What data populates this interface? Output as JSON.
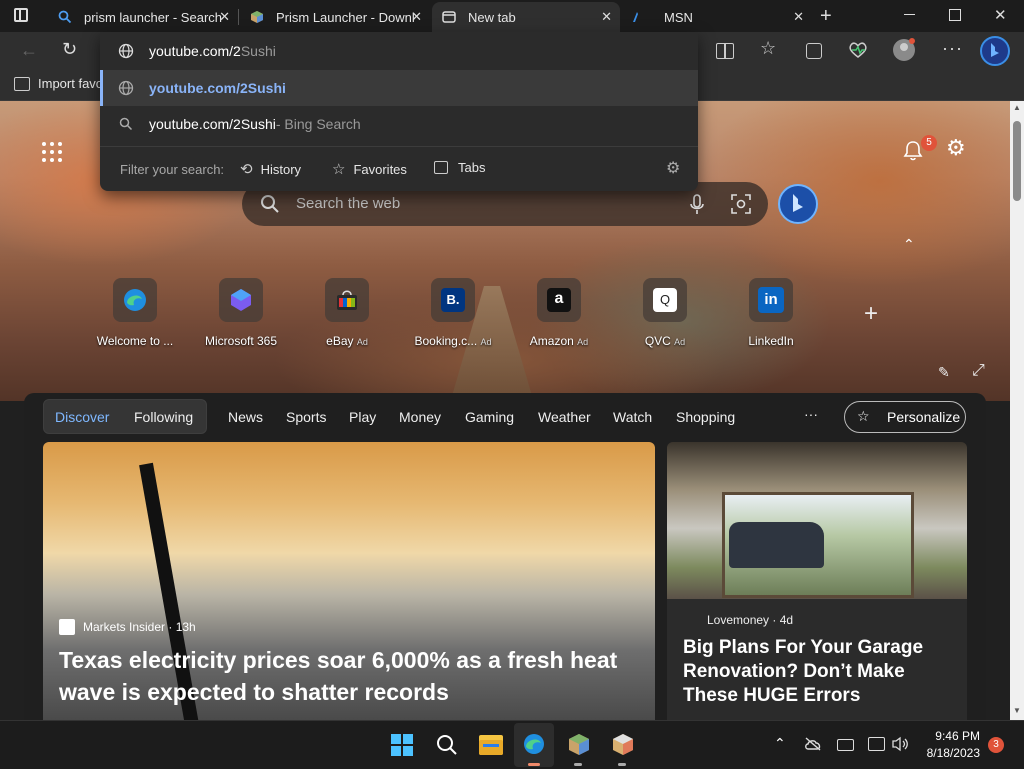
{
  "tabs": [
    {
      "label": "prism launcher - Search",
      "icon": "search-favicon"
    },
    {
      "label": "Prism Launcher - Downl",
      "icon": "prism-favicon"
    },
    {
      "label": "New tab",
      "icon": "newtab-favicon",
      "active": true
    },
    {
      "label": "MSN",
      "icon": "msn-favicon"
    }
  ],
  "address": {
    "typed": "youtube.com/2",
    "completion": "Sushi",
    "suggestions": [
      {
        "text": "youtube.com/2Sushi",
        "icon": "globe-icon",
        "highlighted": true
      },
      {
        "text": "youtube.com/2Sushi",
        "suffix": " - Bing Search",
        "icon": "search-icon"
      }
    ],
    "filter_label": "Filter your search:",
    "filters": [
      "History",
      "Favorites",
      "Tabs"
    ]
  },
  "favorites_bar": {
    "import_label": "Import favo"
  },
  "newtab": {
    "search_placeholder": "Search the web",
    "notification_count": "5",
    "quick_links": [
      {
        "label": "Welcome to ...",
        "ad": ""
      },
      {
        "label": "Microsoft 365",
        "ad": ""
      },
      {
        "label": "eBay",
        "ad": "Ad"
      },
      {
        "label": "Booking.c...",
        "ad": "Ad"
      },
      {
        "label": "Amazon",
        "ad": "Ad"
      },
      {
        "label": "QVC",
        "ad": "Ad"
      },
      {
        "label": "LinkedIn",
        "ad": ""
      }
    ]
  },
  "feed": {
    "nav": [
      "Discover",
      "Following",
      "News",
      "Sports",
      "Play",
      "Money",
      "Gaming",
      "Weather",
      "Watch",
      "Shopping"
    ],
    "more": "···",
    "personalize": "Personalize",
    "main_story": {
      "source": "Markets Insider",
      "age": " · 13h",
      "headline": "Texas electricity prices soar 6,000% as a fresh heat wave is expected to shatter records"
    },
    "side_story": {
      "source": "Lovemoney",
      "age": " · 4d",
      "headline": "Big Plans For Your Garage Renovation? Don’t Make These HUGE Errors"
    }
  },
  "taskbar": {
    "time": "9:46 PM",
    "date": "8/18/2023",
    "notifications": "3"
  },
  "colors": {
    "accent": "#3a8ee6",
    "badge": "#e0533a",
    "link_blue": "#8ab4f8"
  }
}
